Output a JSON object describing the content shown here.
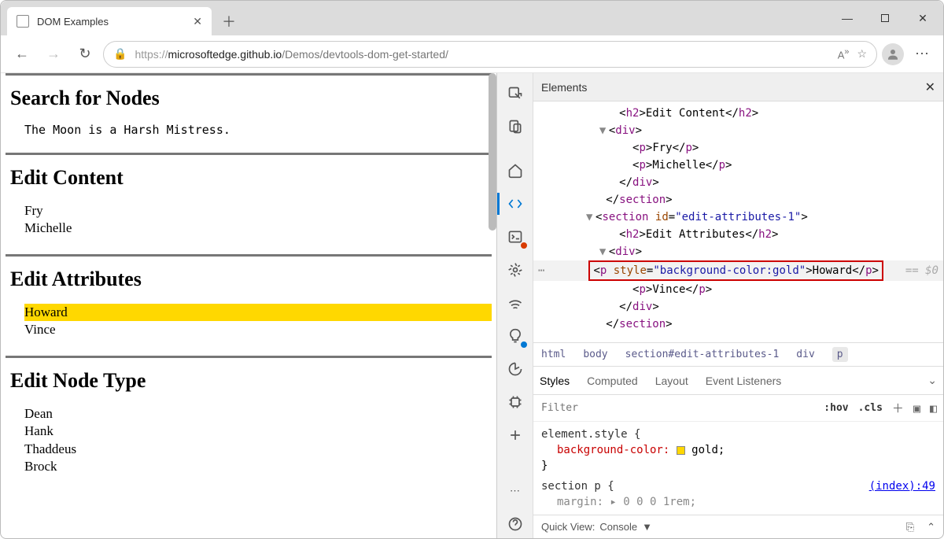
{
  "tab": {
    "title": "DOM Examples"
  },
  "url": {
    "protocol": "https://",
    "domain": "microsoftedge.github.io",
    "path": "/Demos/devtools-dom-get-started/"
  },
  "page": {
    "h_search": "Search for Nodes",
    "search_text": "The Moon is a Harsh Mistress.",
    "h_edit_content": "Edit Content",
    "edit_content_items": [
      "Fry",
      "Michelle"
    ],
    "h_edit_attrs": "Edit Attributes",
    "edit_attr_items": [
      "Howard",
      "Vince"
    ],
    "h_edit_node": "Edit Node Type",
    "edit_node_items": [
      "Dean",
      "Hank",
      "Thaddeus",
      "Brock"
    ]
  },
  "devtools": {
    "panel_title": "Elements",
    "dom": {
      "l1": "<h2>Edit Content</h2>",
      "l2a": "<div>",
      "l2b": "</div>",
      "l3": "<p>Fry</p>",
      "l4": "<p>Michelle</p>",
      "l5": "</section>",
      "l6_open": "<section",
      "l6_attr": "id",
      "l6_val": "\"edit-attributes-1\"",
      "l6_close": ">",
      "l7": "<h2>Edit Attributes</h2>",
      "sel_open": "<p ",
      "sel_attr": "style",
      "sel_eq": "=",
      "sel_val": "\"background-color:gold\"",
      "sel_mid": ">",
      "sel_txt": "Howard",
      "sel_close": "</p>",
      "l9": "<p>Vince</p>",
      "eq0": "== $0"
    },
    "crumbs": [
      "html",
      "body",
      "section#edit-attributes-1",
      "div",
      "p"
    ],
    "style_tabs": [
      "Styles",
      "Computed",
      "Layout",
      "Event Listeners"
    ],
    "filter_placeholder": "Filter",
    "hov": ":hov",
    "cls": ".cls",
    "rule1_sel": "element.style {",
    "rule1_prop": "background-color:",
    "rule1_val": "gold;",
    "rule1_close": "}",
    "rule2_sel": "section p {",
    "rule2_link": "(index):49",
    "rule2_line": "margin: ▸ 0 0 0 1rem;",
    "quickview_label": "Quick View:",
    "quickview_val": "Console"
  }
}
